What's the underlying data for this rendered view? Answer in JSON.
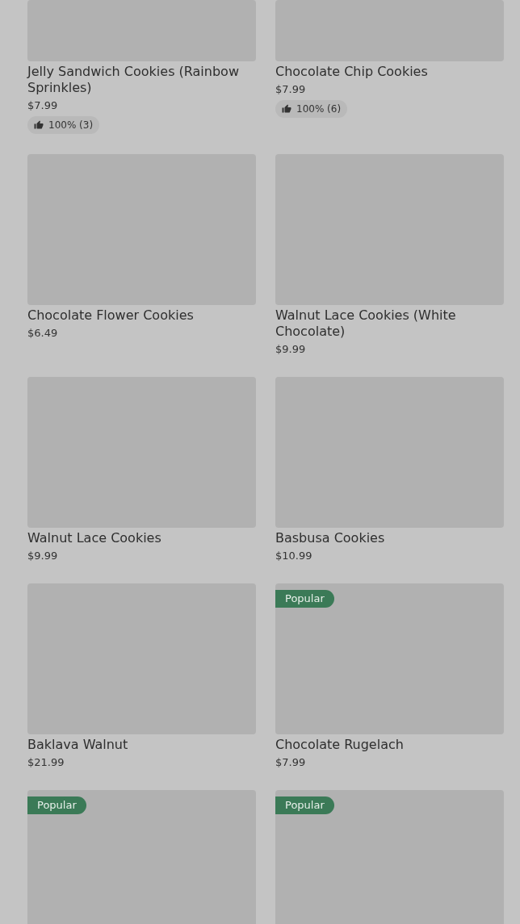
{
  "items": [
    {
      "title": "Jelly Sandwich Cookies (Rainbow Sprinkles)",
      "price": "$7.99",
      "rating": "100% (3)"
    },
    {
      "title": "Chocolate Chip Cookies",
      "price": "$7.99",
      "rating": "100% (6)"
    },
    {
      "title": "Chocolate Flower Cookies",
      "price": "$6.49"
    },
    {
      "title": "Walnut Lace Cookies (White Chocolate)",
      "price": "$9.99"
    },
    {
      "title": "Walnut Lace Cookies",
      "price": "$9.99"
    },
    {
      "title": "Basbusa Cookies",
      "price": "$10.99"
    },
    {
      "title": "Baklava Walnut",
      "price": "$21.99"
    },
    {
      "title": "Chocolate Rugelach",
      "price": "$7.99",
      "badge": "Popular"
    },
    {
      "badge": "Popular"
    },
    {
      "badge": "Popular"
    }
  ]
}
